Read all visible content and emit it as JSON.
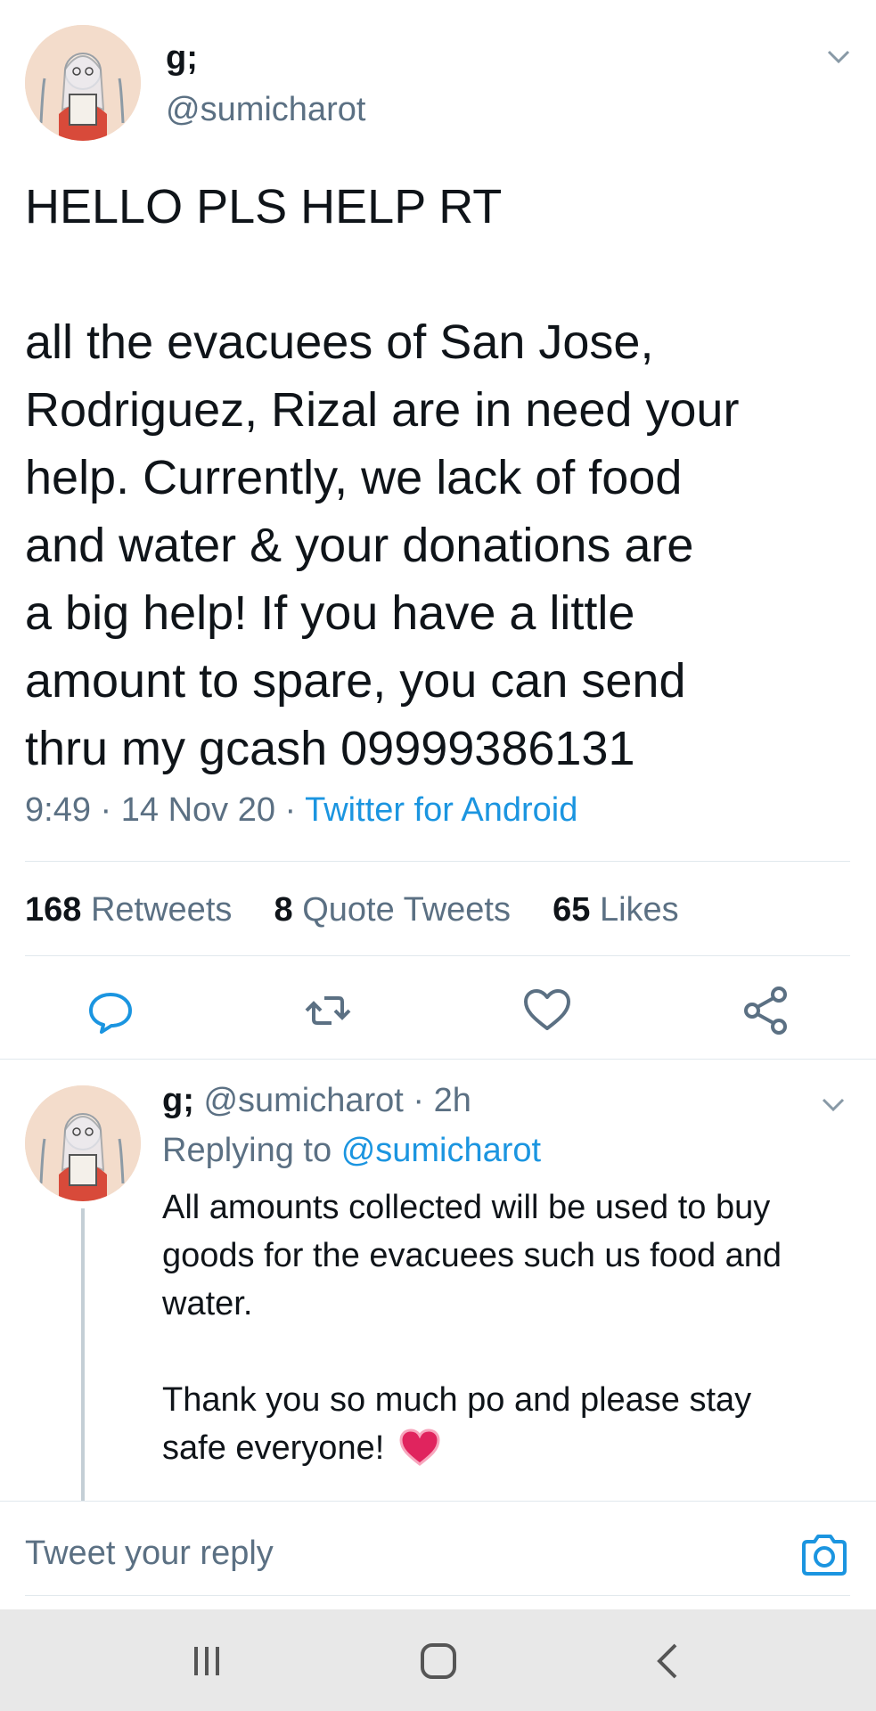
{
  "tweet": {
    "display_name": "g;",
    "handle": "@sumicharot",
    "text_line1": "HELLO PLS HELP RT",
    "body_lines": [
      "all the evacuees of San Jose,",
      "Rodriguez, Rizal are in need your",
      "help. Currently, we lack of food",
      "and water & your donations are",
      "a big help! If you have a little",
      "amount to spare, you can send",
      "thru my gcash 09999386131"
    ],
    "time": "9:49",
    "date": "14 Nov 20",
    "source": "Twitter for Android",
    "separator": "·"
  },
  "stats": {
    "retweets_count": "168",
    "retweets_label": "Retweets",
    "quotes_count": "8",
    "quotes_label": "Quote Tweets",
    "likes_count": "65",
    "likes_label": "Likes"
  },
  "actions": [
    "reply-icon",
    "retweet-icon",
    "like-icon",
    "share-icon"
  ],
  "reply": {
    "display_name": "g;",
    "handle": "@sumicharot",
    "time": "2h",
    "replying_label": "Replying to",
    "replying_handle": "@sumicharot",
    "lines": [
      "All amounts collected will be used to buy",
      "goods for the evacuees such us food and",
      "water."
    ],
    "lines2": [
      "Thank you so much po and please stay",
      "safe everyone!"
    ]
  },
  "composer": {
    "placeholder": "Tweet your reply"
  },
  "colors": {
    "link": "#1b95e0",
    "muted": "#5b7083",
    "heart": "#e0245e"
  }
}
